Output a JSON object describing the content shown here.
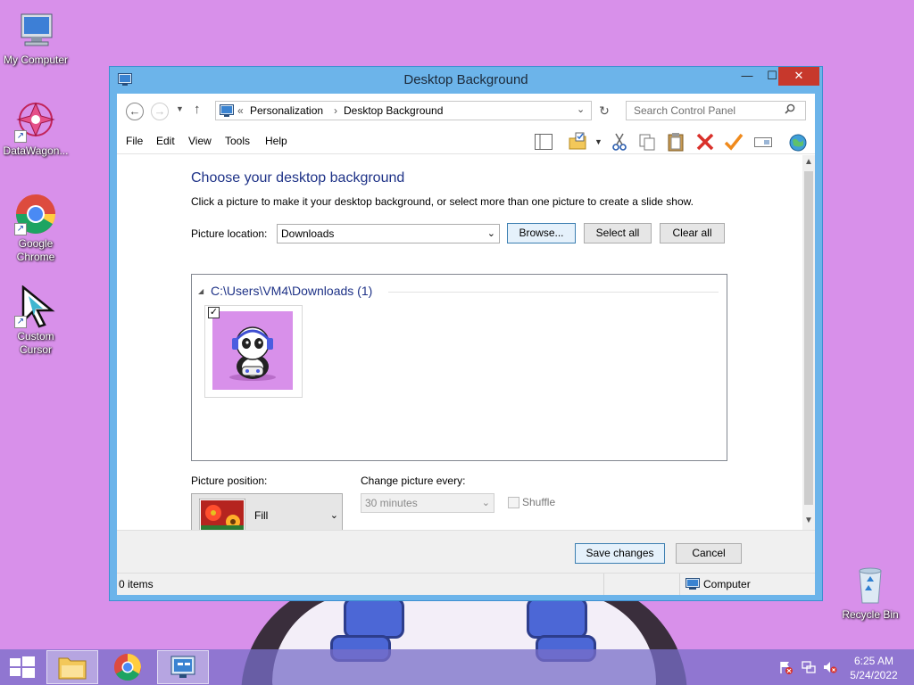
{
  "desktop": {
    "icons": [
      {
        "label": "My Computer"
      },
      {
        "label": "DataWagon..."
      },
      {
        "label": "Google Chrome"
      },
      {
        "label": "Custom Cursor"
      },
      {
        "label": "Recycle Bin"
      }
    ]
  },
  "window": {
    "title": "Desktop Background",
    "controls": {
      "minimize": "—",
      "maximize": "☐",
      "close": "✕"
    }
  },
  "address": {
    "overflow": "«",
    "crumbs": [
      "Personalization",
      "Desktop Background"
    ],
    "separator": "›"
  },
  "search": {
    "placeholder": "Search Control Panel"
  },
  "menu": [
    "File",
    "Edit",
    "View",
    "Tools",
    "Help"
  ],
  "toolbar_icons": [
    "layout-icon",
    "folder-properties-icon",
    "cut-icon",
    "copy-icon",
    "paste-icon",
    "delete-icon",
    "checkmark-icon",
    "rename-icon",
    "world-icon"
  ],
  "main": {
    "heading": "Choose your desktop background",
    "subtext": "Click a picture to make it your desktop background, or select more than one picture to create a slide show.",
    "picture_location_label": "Picture location:",
    "picture_location_value": "Downloads",
    "browse": "Browse...",
    "select_all": "Select all",
    "clear_all": "Clear all",
    "group_header": "C:\\Users\\VM4\\Downloads (1)",
    "thumb_checked": true,
    "picture_position_label": "Picture position:",
    "picture_position_value": "Fill",
    "change_every_label": "Change picture every:",
    "change_every_value": "30 minutes",
    "shuffle": "Shuffle"
  },
  "footer": {
    "save": "Save changes",
    "cancel": "Cancel"
  },
  "status": {
    "items": "0 items",
    "zone": "Computer"
  },
  "taskbar": {
    "time": "6:25 AM",
    "date": "5/24/2022"
  },
  "colors": {
    "desktop": "#d890ea",
    "title_bar": "#6cb4ea",
    "close_button": "#c7382c",
    "heading_text": "#1e3287"
  }
}
